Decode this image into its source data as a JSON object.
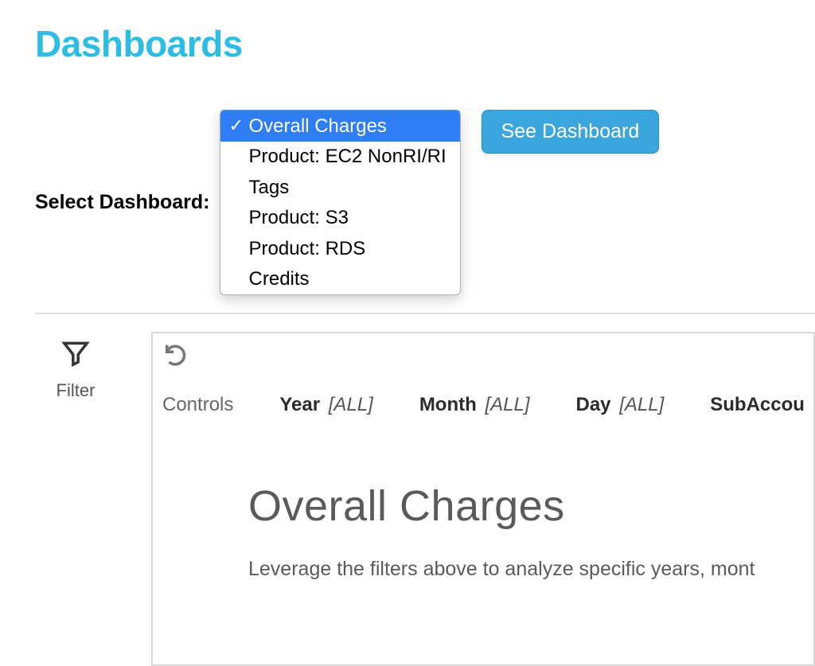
{
  "page": {
    "title": "Dashboards"
  },
  "selector": {
    "label": "Select Dashboard:",
    "options": [
      "Overall Charges",
      "Product: EC2 NonRI/RI",
      "Tags",
      "Product: S3",
      "Product: RDS",
      "Credits"
    ],
    "selected_index": 0,
    "button_label": "See Dashboard"
  },
  "sidebar": {
    "filter_label": "Filter"
  },
  "controls": {
    "label": "Controls",
    "items": [
      {
        "name": "Year",
        "value": "[ALL]"
      },
      {
        "name": "Month",
        "value": "[ALL]"
      },
      {
        "name": "Day",
        "value": "[ALL]"
      },
      {
        "name": "SubAccou",
        "value": ""
      }
    ]
  },
  "content": {
    "title": "Overall Charges",
    "description": "Leverage the filters above to analyze specific years, mont"
  }
}
